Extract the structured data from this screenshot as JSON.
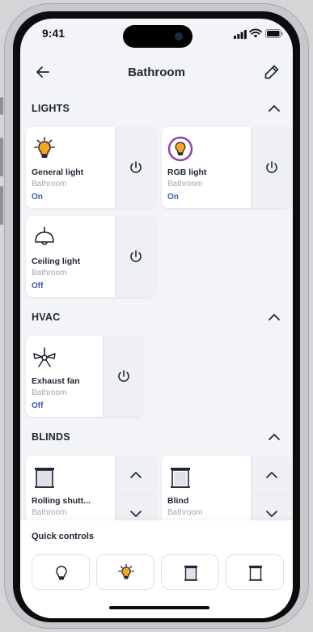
{
  "status_bar": {
    "time": "9:41"
  },
  "header": {
    "title": "Bathroom",
    "back_icon": "arrow-left-icon",
    "edit_icon": "pencil-icon"
  },
  "sections": {
    "lights": {
      "label": "LIGHTS"
    },
    "hvac": {
      "label": "HVAC"
    },
    "blinds": {
      "label": "BLINDS"
    }
  },
  "devices": {
    "general_light": {
      "name": "General light",
      "room": "Bathroom",
      "state": "On",
      "icon": "bulb-on-icon"
    },
    "rgb_light": {
      "name": "RGB light",
      "room": "Bathroom",
      "state": "On",
      "icon": "rgb-bulb-icon"
    },
    "ceiling_light": {
      "name": "Ceiling light",
      "room": "Bathroom",
      "state": "Off",
      "icon": "ceiling-lamp-icon"
    },
    "exhaust_fan": {
      "name": "Exhaust fan",
      "room": "Bathroom",
      "state": "Off",
      "icon": "fan-icon"
    },
    "rolling_shutter": {
      "name": "Rolling shutt...",
      "room": "Bathroom",
      "icon": "shutter-icon"
    },
    "blind": {
      "name": "Blind",
      "room": "Bathroom",
      "icon": "blind-icon"
    }
  },
  "quick_controls": {
    "label": "Quick controls",
    "buttons": [
      "bulb-off-icon",
      "bulb-on-icon",
      "shutter-icon",
      "blind-icon"
    ]
  },
  "colors": {
    "accent": "#3a5ba8",
    "bulb_on": "#f5a623",
    "rgb_ring": "#8e44ad"
  }
}
